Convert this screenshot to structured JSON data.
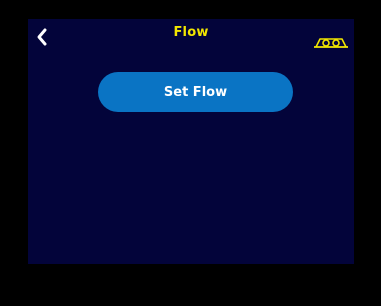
{
  "header": {
    "title": "Flow",
    "back_icon": "chevron-left-icon",
    "status_icon": "cassette-icon"
  },
  "main": {
    "set_flow_label": "Set Flow"
  },
  "colors": {
    "screen_background": "#03043a",
    "title": "#f2e600",
    "button": "#0a74c4",
    "button_text": "#ffffff",
    "back_icon": "#ffffff",
    "status_icon": "#f2e600"
  }
}
